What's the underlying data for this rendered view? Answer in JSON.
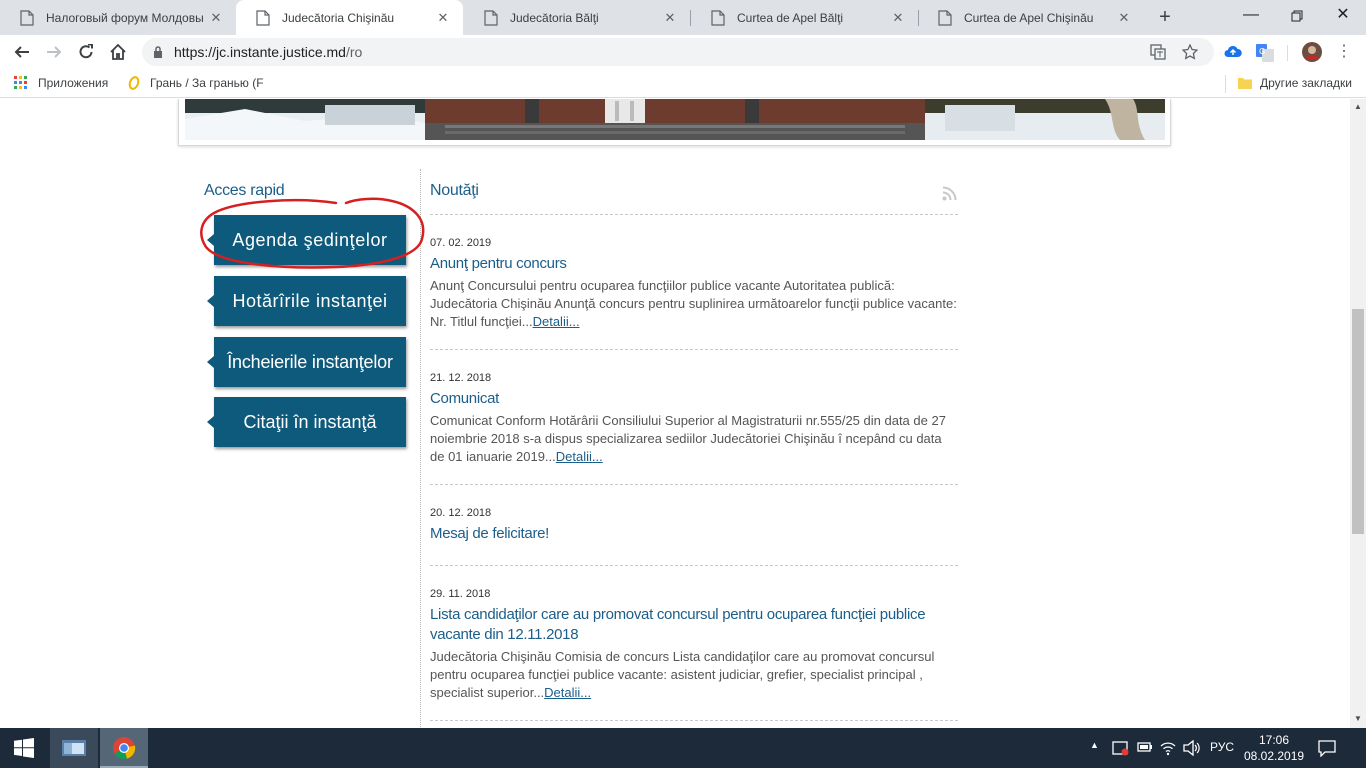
{
  "browser": {
    "tabs": [
      {
        "title": "Налоговый форум Молдовы",
        "active": false
      },
      {
        "title": "Judecătoria Chişinău",
        "active": true
      },
      {
        "title": "Judecătoria Bălţi",
        "active": false
      },
      {
        "title": "Curtea de Apel Bălţi",
        "active": false
      },
      {
        "title": "Curtea de Apel Chişinău",
        "active": false
      }
    ],
    "url_host": "https://jc.instante.justice.md",
    "url_path": "/ro",
    "bookmarks": {
      "apps": "Приложения",
      "item1": "Грань / За гранью (F",
      "other": "Другие закладки"
    }
  },
  "page": {
    "quick_access": {
      "title": "Acces rapid",
      "buttons": [
        "Agenda şedinţelor",
        "Hotărîrile instanţei",
        "Încheierile instanţelor",
        "Citaţii în instanţă"
      ]
    },
    "news": {
      "title": "Noutăţi",
      "items": [
        {
          "date": "07. 02. 2019",
          "title": "Anunţ pentru concurs",
          "text": "Anunţ Concursului pentru ocuparea funcţiilor publice vacante Autoritatea publică: Judecătoria Chişinău Anunţă concurs pentru suplinirea următoarelor funcţii publice vacante: Nr. Titlul funcţiei...",
          "more": "Detalii..."
        },
        {
          "date": "21. 12. 2018",
          "title": "Comunicat",
          "text": "Comunicat Conform Hotărârii Consiliului Superior al Magistraturii nr.555/25 din data de 27 noiembrie 2018 s-a dispus specializarea sediilor Judecătoriei Chişinău î ncepând cu data de 01 ianuarie 2019...",
          "more": "Detalii..."
        },
        {
          "date": "20. 12. 2018",
          "title": "Mesaj de felicitare!",
          "text": "",
          "more": ""
        },
        {
          "date": "29. 11. 2018",
          "title": "Lista candidaţilor care au promovat concursul pentru ocuparea funcţiei publice vacante din 12.11.2018",
          "text": "Judecătoria Chişinău Comisia de concurs Lista candidaţilor care au promovat concursul pentru ocuparea funcţiei publice vacante: asistent judiciar, grefier, specialist principal , specialist superior...",
          "more": "Detalii..."
        }
      ]
    }
  },
  "taskbar": {
    "lang": "РУС",
    "time": "17:06",
    "date": "08.02.2019"
  },
  "colors": {
    "accent": "#0e5a7c",
    "link": "#1b5e8a",
    "annotation": "#d62020"
  }
}
